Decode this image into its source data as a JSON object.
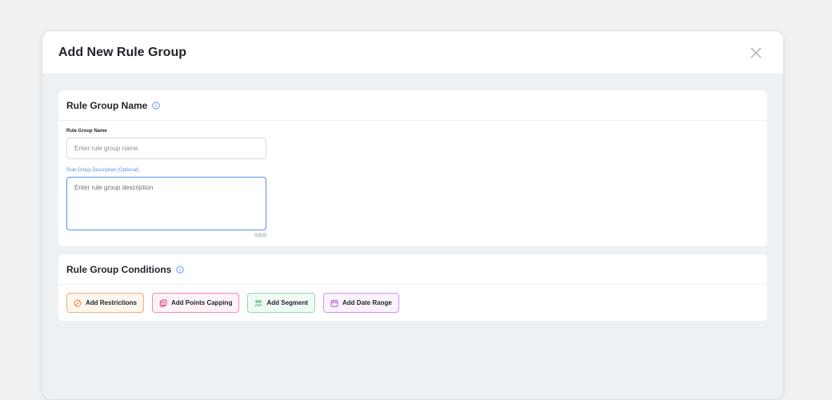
{
  "modal": {
    "title": "Add New Rule Group",
    "close_icon": "close-icon"
  },
  "name_section": {
    "title": "Rule Group Name",
    "info_icon": "info-icon",
    "name_label": "Rule Group Name",
    "name_value": "",
    "name_placeholder": "Enter rule group name",
    "description_label": "Rule Group Description (Optional)",
    "description_value": "",
    "description_placeholder": "Enter rule group description",
    "char_counter": "0/300"
  },
  "conditions_section": {
    "title": "Rule Group Conditions",
    "info_icon": "info-icon",
    "buttons": [
      {
        "label": "Add Restrictions",
        "icon": "restriction-icon",
        "color": "#f07a2a"
      },
      {
        "label": "Add Points Capping",
        "icon": "points-capping-icon",
        "color": "#e0347c"
      },
      {
        "label": "Add Segment",
        "icon": "segment-icon",
        "color": "#27a35a"
      },
      {
        "label": "Add Date Range",
        "icon": "calendar-icon",
        "color": "#a64fd6"
      }
    ]
  },
  "colors": {
    "accent": "#5b8def",
    "background": "#edf1f4"
  }
}
